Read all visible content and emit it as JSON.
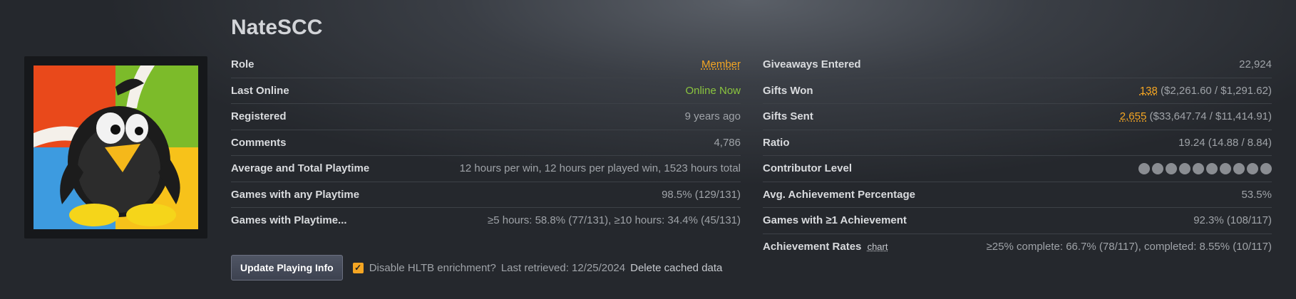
{
  "profile": {
    "username": "NateSCC"
  },
  "left_stats": [
    {
      "label": "Role",
      "value": "Member"
    },
    {
      "label": "Last Online",
      "value": "Online Now"
    },
    {
      "label": "Registered",
      "value": "9 years ago"
    },
    {
      "label": "Comments",
      "value": "4,786"
    },
    {
      "label": "Average and Total Playtime",
      "value": "12 hours per win, 12 hours per played win, 1523 hours total"
    },
    {
      "label": "Games with any Playtime",
      "value": "98.5% (129/131)"
    },
    {
      "label": "Games with Playtime...",
      "value": "≥5 hours: 58.8% (77/131), ≥10 hours: 34.4% (45/131)"
    }
  ],
  "right_stats": [
    {
      "label": "Giveaways Entered",
      "value": "22,924"
    },
    {
      "label": "Gifts Won",
      "count": "138",
      "detail": "($2,261.60 / $1,291.62)"
    },
    {
      "label": "Gifts Sent",
      "count": "2,655",
      "detail": "($33,647.74 / $11,414.91)"
    },
    {
      "label": "Ratio",
      "value": "19.24 (14.88 / 8.84)"
    },
    {
      "label": "Contributor Level",
      "value": ""
    },
    {
      "label": "Avg. Achievement Percentage",
      "value": "53.5%"
    },
    {
      "label": "Games with ≥1 Achievement",
      "value": "92.3% (108/117)"
    },
    {
      "label": "Achievement Rates",
      "link": "chart",
      "value": "≥25% complete: 66.7% (78/117), completed: 8.55% (10/117)"
    }
  ],
  "footer": {
    "update_button": "Update Playing Info",
    "checkbox_label": "Disable HLTB enrichment?",
    "checkbox_checked": true,
    "retrieved": "Last retrieved: 12/25/2024",
    "delete_link": "Delete cached data"
  },
  "colors": {
    "accent": "#f5a623",
    "online": "#8bc53f"
  },
  "icons": {
    "checkbox": "check-icon",
    "contributor_dots": 10
  }
}
